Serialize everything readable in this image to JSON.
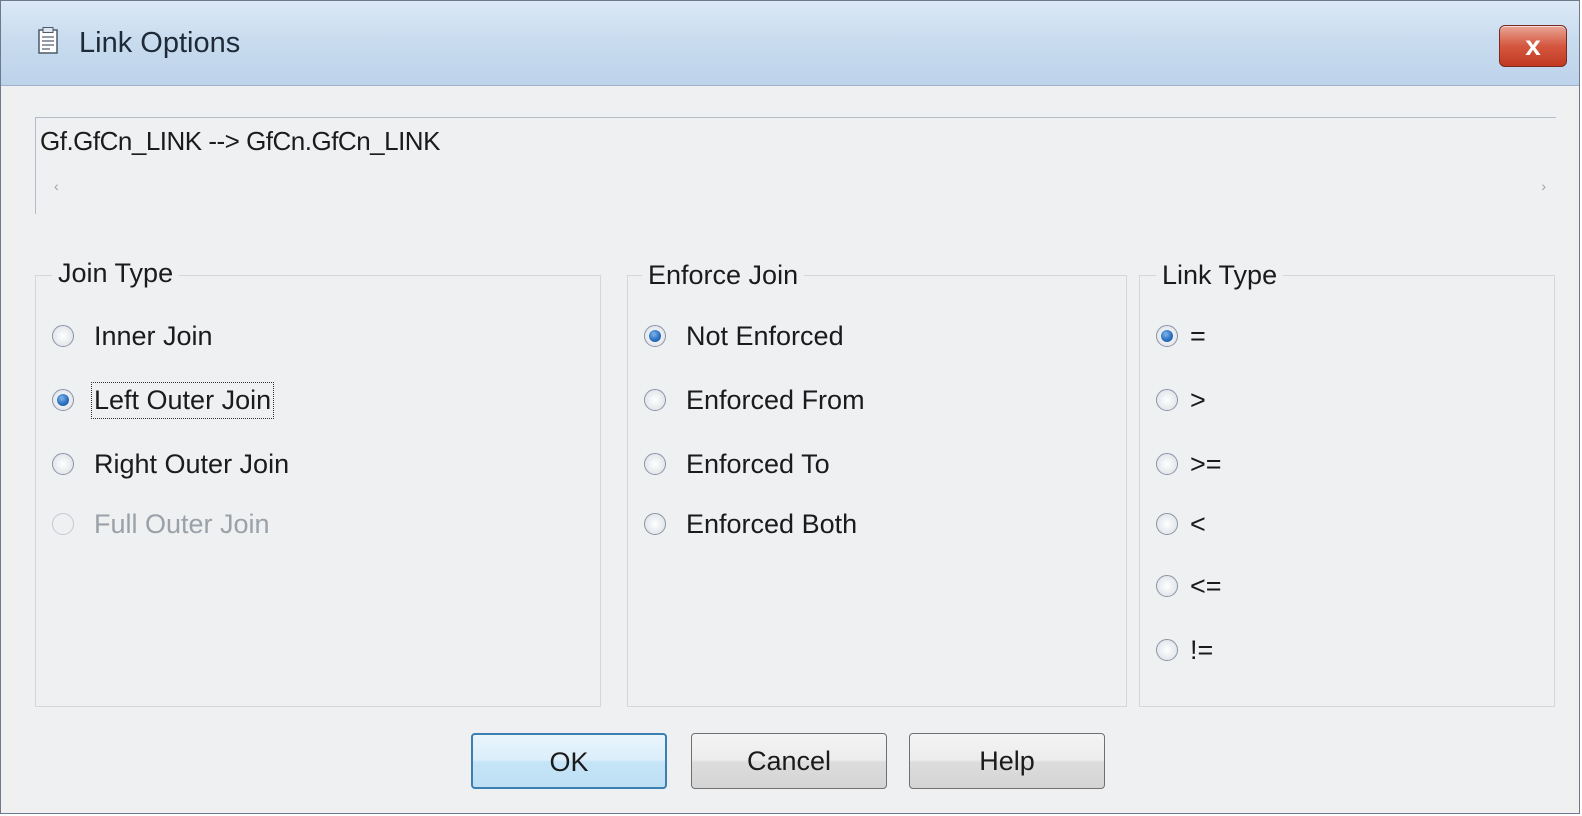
{
  "window": {
    "title": "Link Options",
    "close_label": "x"
  },
  "path": {
    "text": "Gf.GfCn_LINK --> GfCn.GfCn_LINK",
    "scroll_left": "‹",
    "scroll_right": "›"
  },
  "join_type": {
    "label": "Join Type",
    "options": [
      {
        "label": "Inner Join",
        "checked": false,
        "enabled": true
      },
      {
        "label": "Left Outer Join",
        "checked": true,
        "enabled": true
      },
      {
        "label": "Right Outer Join",
        "checked": false,
        "enabled": true
      },
      {
        "label": "Full Outer Join",
        "checked": false,
        "enabled": false
      }
    ]
  },
  "enforce_join": {
    "label": "Enforce Join",
    "options": [
      {
        "label": "Not Enforced",
        "checked": true
      },
      {
        "label": "Enforced From",
        "checked": false
      },
      {
        "label": "Enforced To",
        "checked": false
      },
      {
        "label": "Enforced Both",
        "checked": false
      }
    ]
  },
  "link_type": {
    "label": "Link Type",
    "options": [
      {
        "label": "=",
        "checked": true
      },
      {
        "label": ">",
        "checked": false
      },
      {
        "label": ">=",
        "checked": false
      },
      {
        "label": "<",
        "checked": false
      },
      {
        "label": "<=",
        "checked": false
      },
      {
        "label": "!=",
        "checked": false
      }
    ]
  },
  "buttons": {
    "ok": "OK",
    "cancel": "Cancel",
    "help": "Help"
  },
  "colors": {
    "title_gradient_top": "#dce9f6",
    "close_button": "#c23a22",
    "radio_checked": "#2a6fbf"
  }
}
